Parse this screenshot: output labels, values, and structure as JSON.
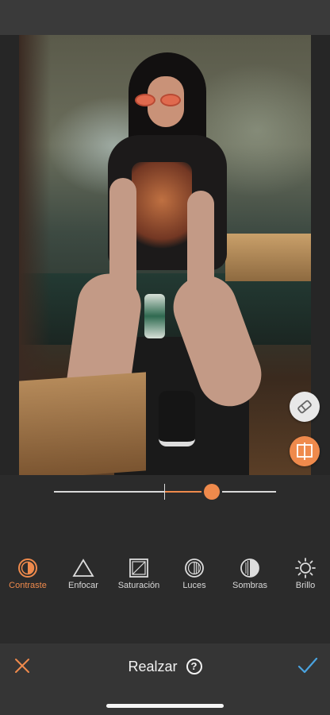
{
  "editor": {
    "slider_value_percent": 71
  },
  "side_buttons": [
    {
      "name": "eraser-icon"
    },
    {
      "name": "compare-split-icon"
    }
  ],
  "tools": [
    {
      "label": "Contraste",
      "icon": "contrast-icon",
      "active": true
    },
    {
      "label": "Enfocar",
      "icon": "sharpen-triangle-icon",
      "active": false
    },
    {
      "label": "Saturación",
      "icon": "saturation-icon",
      "active": false
    },
    {
      "label": "Luces",
      "icon": "highlights-icon",
      "active": false
    },
    {
      "label": "Sombras",
      "icon": "shadows-icon",
      "active": false
    },
    {
      "label": "Brillo",
      "icon": "brightness-sun-icon",
      "active": false
    }
  ],
  "bottom_bar": {
    "title": "Realzar",
    "help_glyph": "?",
    "close_icon": "close-icon",
    "confirm_icon": "check-icon"
  },
  "colors": {
    "accent": "#ef8a4c",
    "confirm": "#4aa3df",
    "background": "#2b2b2b"
  }
}
